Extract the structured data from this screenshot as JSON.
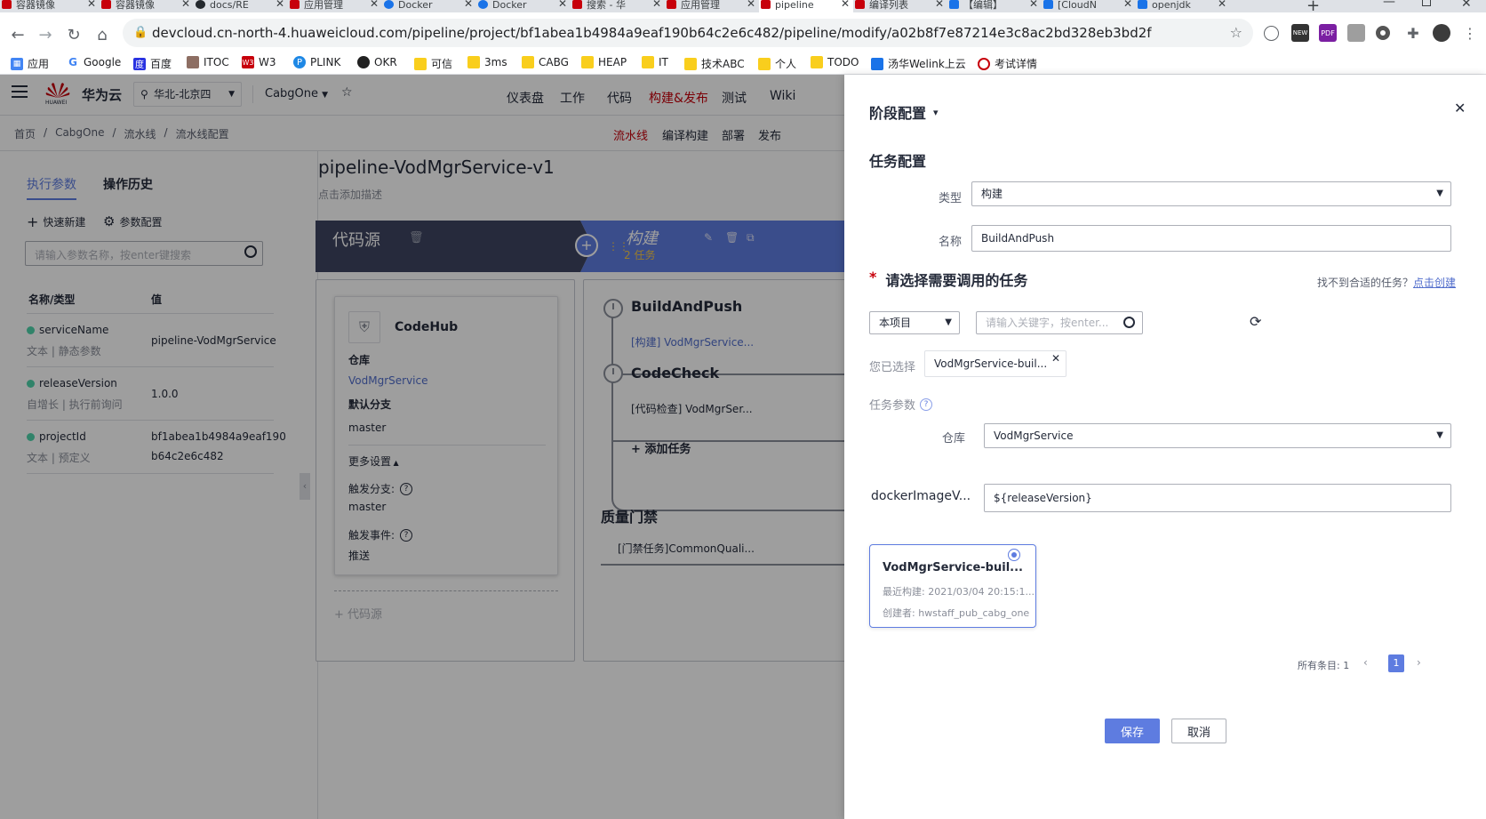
{
  "browser": {
    "tabs": [
      {
        "label": "容器镜像",
        "color": "#c7000b"
      },
      {
        "label": "容器镜像",
        "color": "#c7000b"
      },
      {
        "label": "docs/RE",
        "color": "#24292e"
      },
      {
        "label": "应用管理",
        "color": "#c7000b"
      },
      {
        "label": "Docker",
        "color": "#1a73e8"
      },
      {
        "label": "Docker",
        "color": "#1a73e8"
      },
      {
        "label": "搜索 - 华",
        "color": "#c7000b"
      },
      {
        "label": "应用管理",
        "color": "#c7000b"
      },
      {
        "label": "pipeline",
        "color": "#c7000b"
      },
      {
        "label": "编译列表",
        "color": "#c7000b"
      },
      {
        "label": "【编辑】",
        "color": "#1a73e8"
      },
      {
        "label": "[CloudN",
        "color": "#1a73e8"
      },
      {
        "label": "openjdk",
        "color": "#1a73e8"
      }
    ],
    "url": "devcloud.cn-north-4.huaweicloud.com/pipeline/project/bf1abea1b4984a9eaf190b64c2e6c482/pipeline/modify/a02b8f7e87214e3c8ac2bd328eb3bd2f",
    "bookmarks": [
      "应用",
      "Google",
      "百度",
      "ITOC",
      "W3",
      "PLINK",
      "OKR",
      "可信",
      "3ms",
      "CABG",
      "HEAP",
      "IT",
      "技术ABC",
      "个人",
      "TODO",
      "汤华Welink上云",
      "考试详情"
    ]
  },
  "header": {
    "brand": "华为云",
    "brand_small": "HUAWEI",
    "region": "华北-北京四",
    "project": "CabgOne",
    "nav": [
      "仪表盘",
      "工作",
      "代码",
      "构建&发布",
      "测试",
      "Wiki"
    ],
    "active_nav": "构建&发布"
  },
  "subheader": {
    "breadcrumb": [
      "首页",
      "CabgOne",
      "流水线",
      "流水线配置"
    ],
    "subnav": [
      "流水线",
      "编译构建",
      "部署",
      "发布"
    ]
  },
  "left": {
    "tabs": [
      "执行参数",
      "操作历史"
    ],
    "quick_add": "快速新建",
    "param_config": "参数配置",
    "search_placeholder": "请输入参数名称，按enter键搜索",
    "col_name": "名称/类型",
    "col_value": "值",
    "params": [
      {
        "name": "serviceName",
        "type": "文本 | 静态参数",
        "value": "pipeline-VodMgrService",
        "value2": ""
      },
      {
        "name": "releaseVersion",
        "type": "自增长 | 执行前询问",
        "value": "1.0.0",
        "value2": ""
      },
      {
        "name": "projectId",
        "type": "文本 | 预定义",
        "value": "bf1abea1b4984a9eaf190",
        "value2": "b64c2e6c482"
      }
    ]
  },
  "main": {
    "pipeline_name": "pipeline-VodMgrService-v1",
    "desc_hint": "点击添加描述",
    "stage1": "代码源",
    "stage2": "构建",
    "stage2_count": "2 任务",
    "codehub": {
      "title": "CodeHub",
      "repo_label": "仓库",
      "repo": "VodMgrService",
      "branch_label": "默认分支",
      "branch": "master",
      "more": "更多设置",
      "trigger_branch_label": "触发分支:",
      "trigger_branch": "master",
      "trigger_event_label": "触发事件:",
      "trigger_event": "推送"
    },
    "add_source": "代码源",
    "tasks": [
      {
        "title": "BuildAndPush",
        "sub": "[构建] VodMgrService..."
      },
      {
        "title": "CodeCheck",
        "sub": "[代码检查] VodMgrSer..."
      }
    ],
    "add_task": "添加任务",
    "quality_gate": "质量门禁",
    "gate_task": "[门禁任务]CommonQuali..."
  },
  "panel": {
    "title": "阶段配置",
    "section": "任务配置",
    "type_label": "类型",
    "type_value": "构建",
    "name_label": "名称",
    "name_value": "BuildAndPush",
    "select_title": "请选择需要调用的任务",
    "not_found": "找不到合适的任务？",
    "create_link": "点击创建",
    "scope": "本项目",
    "search_placeholder": "请输入关键字，按enter...",
    "selected_label": "您已选择",
    "selected_value": "VodMgrService-buil...",
    "params_label": "任务参数",
    "repo_label": "仓库",
    "repo_value": "VodMgrService",
    "docker_label": "dockerImageV...",
    "docker_value": "${releaseVersion}",
    "job_card": {
      "title": "VodMgrService-buil...",
      "recent": "最近构建: 2021/03/04 20:15:1...",
      "creator": "创建者: hwstaff_pub_cabg_one"
    },
    "total": "所有条目: 1",
    "page": "1",
    "save": "保存",
    "cancel": "取消"
  },
  "colors": {
    "stage_dark": "#3e4561",
    "stage_blue": "#5e7ce0",
    "accent_red": "#c7000b",
    "link_blue": "#526ecc",
    "save_btn": "#5e7ce0"
  }
}
